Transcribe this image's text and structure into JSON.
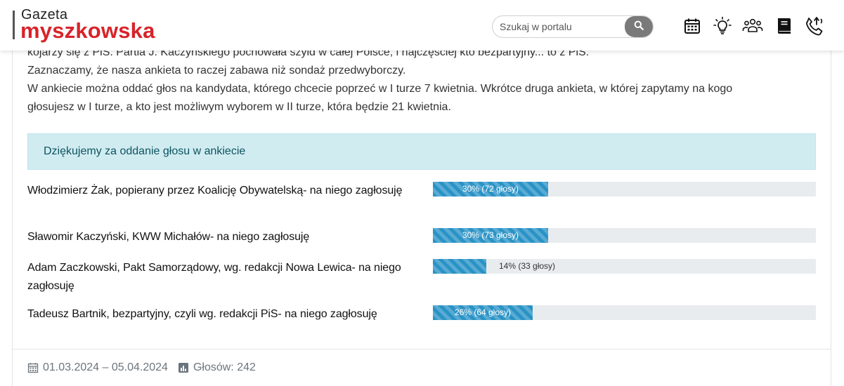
{
  "header": {
    "logo_top": "Gazeta",
    "logo_main": "myszkowska",
    "search_placeholder": "Szukaj w portalu",
    "icons": [
      "calendar-icon",
      "lightbulb-icon",
      "people-icon",
      "book-icon",
      "phone-icon"
    ]
  },
  "article": {
    "lines": [
      "kojarzy się z PiS. Partia J. Kaczyńskiego pochowała szyld w całej Polsce, i najczęściej kto bezpartyjny... to z PiS.",
      "Zaznaczamy, że nasza ankieta to raczej zabawa niż sondaż przedwyborczy.",
      "W ankiecie można oddać głos na kandydata, którego chcecie poprzeć w I turze 7 kwietnia. Wkrótce druga ankieta, w której zapytamy na kogo",
      "głosujesz w I turze, a kto jest możliwym wyborem w II turze, która będzie 21 kwietnia."
    ]
  },
  "poll": {
    "thanks": "Dziękujemy za oddanie głosu w ankiecie",
    "options": [
      {
        "label": "Włodzimierz Żak, popierany przez Koalicję Obywatelską- na niego zagłosuję",
        "percent": 30,
        "votes_text": "30%  (72 głosy)"
      },
      {
        "label": "Sławomir Kaczyński, KWW Michałów- na niego zagłosuję",
        "percent": 30,
        "votes_text": "30%  (73 głosy)"
      },
      {
        "label": "Adam Zaczkowski, Pakt Samorządowy, wg. redakcji Nowa Lewica- na niego zagłosuję",
        "percent": 14,
        "votes_text": "14%  (33 głosy)"
      },
      {
        "label": "Tadeusz Bartnik, bezpartyjny, czyli wg. redakcji PiS- na niego zagłosuję",
        "percent": 26,
        "votes_text": "26%  (64 głosy)"
      }
    ],
    "dates": "01.03.2024 – 05.04.2024",
    "total": "Głosów: 242"
  },
  "colors": {
    "brand": "#d8232a",
    "bar": "#2a93c6",
    "alert_bg": "#d1ecf1"
  }
}
